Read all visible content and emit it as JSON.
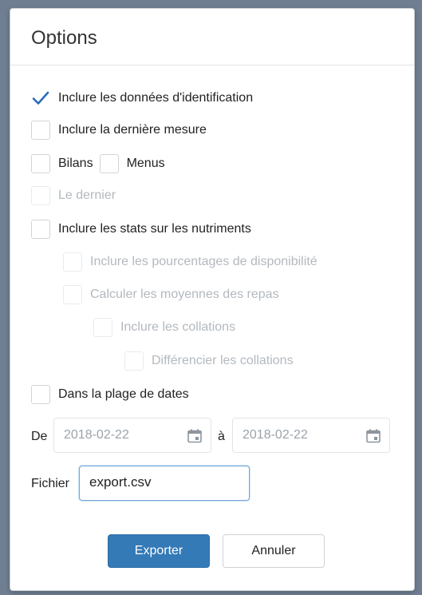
{
  "dialog": {
    "title": "Options",
    "options": {
      "include_identification": {
        "label": "Inclure les données d'identification",
        "checked": true
      },
      "include_last_measure": {
        "label": "Inclure la dernière mesure",
        "checked": false
      },
      "bilans": {
        "label": "Bilans",
        "checked": false
      },
      "menus": {
        "label": "Menus",
        "checked": false
      },
      "le_dernier": {
        "label": "Le dernier",
        "checked": false,
        "disabled": true
      },
      "include_nutrient_stats": {
        "label": "Inclure les stats sur les nutriments",
        "checked": false
      },
      "include_availability_pct": {
        "label": "Inclure les pourcentages de disponibilité",
        "checked": false,
        "disabled": true
      },
      "compute_meal_averages": {
        "label": "Calculer les moyennes des repas",
        "checked": false,
        "disabled": true
      },
      "include_snacks": {
        "label": "Inclure les collations",
        "checked": false,
        "disabled": true
      },
      "differentiate_snacks": {
        "label": "Différencier les collations",
        "checked": false,
        "disabled": true
      },
      "date_range": {
        "label": "Dans la plage de dates",
        "checked": false
      }
    },
    "dates": {
      "from_label": "De",
      "from_value": "2018-02-22",
      "to_label": "à",
      "to_value": "2018-02-22"
    },
    "file": {
      "label": "Fichier",
      "value": "export.csv"
    },
    "buttons": {
      "export": "Exporter",
      "cancel": "Annuler"
    },
    "colors": {
      "primary": "#337ab7",
      "check": "#2a6ebb",
      "disabled_text": "#b3b9bf"
    },
    "icons": {
      "checkmark": "check-icon",
      "calendar": "calendar-icon"
    }
  }
}
